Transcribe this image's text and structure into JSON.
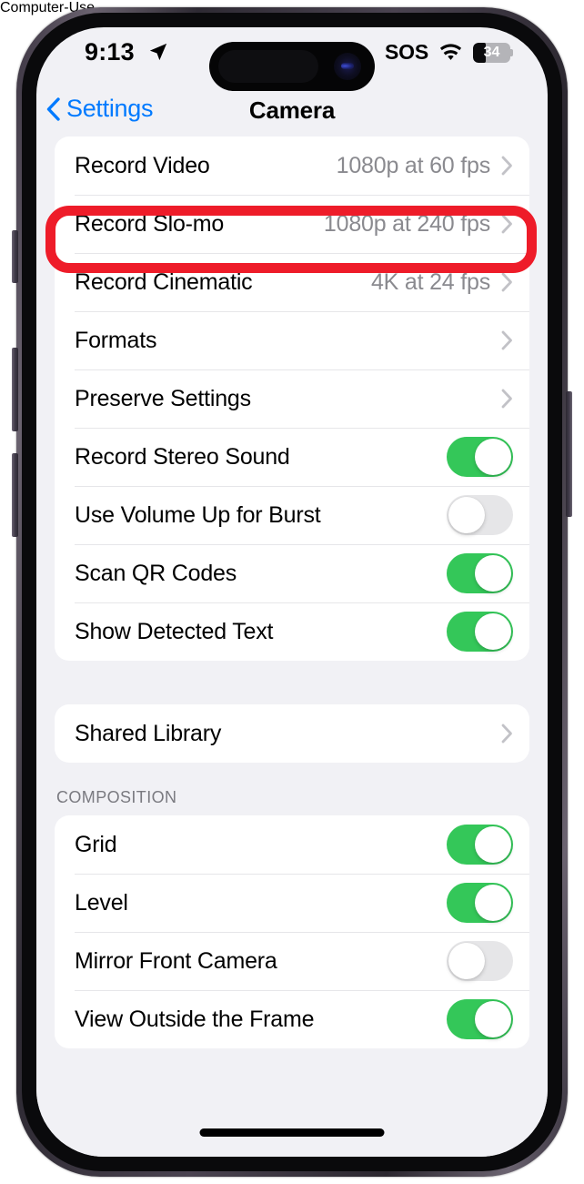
{
  "device": {
    "frame": "iphone-15-pro",
    "side_buttons": [
      "action-button",
      "volume-up-button",
      "volume-down-button",
      "power-button"
    ]
  },
  "status_bar": {
    "time": "9:13",
    "location_icon": "location-arrow-icon",
    "sos": "SOS",
    "wifi_icon": "wifi-icon",
    "battery_percent": "34",
    "battery_level": 34
  },
  "nav": {
    "back_icon": "chevron-left-icon",
    "back_label": "Settings",
    "title": "Camera"
  },
  "annotation": {
    "type": "highlight-rect",
    "color": "#ee1c29",
    "target": "Record Video"
  },
  "colors": {
    "accent_blue": "#007aff",
    "toggle_on": "#34c759",
    "toggle_off": "#e6e6e8",
    "background": "#f1f1f5",
    "card": "#ffffff",
    "value_text": "#8a8a8f",
    "chevron": "#c2c2c7",
    "highlight": "#ee1c29"
  },
  "sections": [
    {
      "header": null,
      "rows": [
        {
          "label": "Record Video",
          "type": "disclosure",
          "value": "1080p at 60 fps",
          "highlighted": true
        },
        {
          "label": "Record Slo-mo",
          "type": "disclosure",
          "value": "1080p at 240 fps",
          "highlighted": false
        },
        {
          "label": "Record Cinematic",
          "type": "disclosure",
          "value": "4K at 24 fps",
          "highlighted": false
        },
        {
          "label": "Formats",
          "type": "disclosure",
          "value": "",
          "highlighted": false
        },
        {
          "label": "Preserve Settings",
          "type": "disclosure",
          "value": "",
          "highlighted": false
        },
        {
          "label": "Record Stereo Sound",
          "type": "toggle",
          "on": true
        },
        {
          "label": "Use Volume Up for Burst",
          "type": "toggle",
          "on": false
        },
        {
          "label": "Scan QR Codes",
          "type": "toggle",
          "on": true
        },
        {
          "label": "Show Detected Text",
          "type": "toggle",
          "on": true
        }
      ]
    },
    {
      "header": null,
      "rows": [
        {
          "label": "Shared Library",
          "type": "disclosure",
          "value": "",
          "highlighted": false
        }
      ]
    },
    {
      "header": "COMPOSITION",
      "rows": [
        {
          "label": "Grid",
          "type": "toggle",
          "on": true
        },
        {
          "label": "Level",
          "type": "toggle",
          "on": true
        },
        {
          "label": "Mirror Front Camera",
          "type": "toggle",
          "on": false
        },
        {
          "label": "View Outside the Frame",
          "type": "toggle",
          "on": true
        }
      ]
    }
  ]
}
